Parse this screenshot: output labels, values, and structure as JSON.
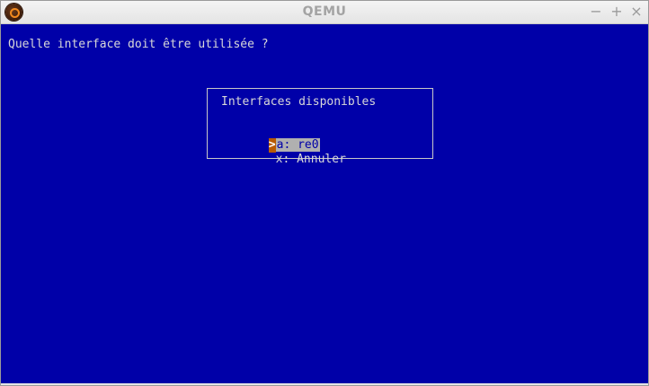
{
  "window": {
    "title": "QEMU",
    "app_icon": "qemu-logo-icon",
    "minimize_glyph": "−",
    "maximize_glyph": "+",
    "close_glyph": "×"
  },
  "screen": {
    "prompt": "Quelle interface doit être utilisée ?",
    "dialog": {
      "title": "Interfaces disponibles",
      "cursor_glyph": ">",
      "items": [
        {
          "label": "a: re0",
          "selected": true
        },
        {
          "label": "x: Annuler",
          "selected": false
        }
      ]
    }
  },
  "colors": {
    "screen_background": "#0000a8",
    "text": "#d8d8d8",
    "cursor": "#b85a00",
    "selection": "#b0b0b0"
  }
}
